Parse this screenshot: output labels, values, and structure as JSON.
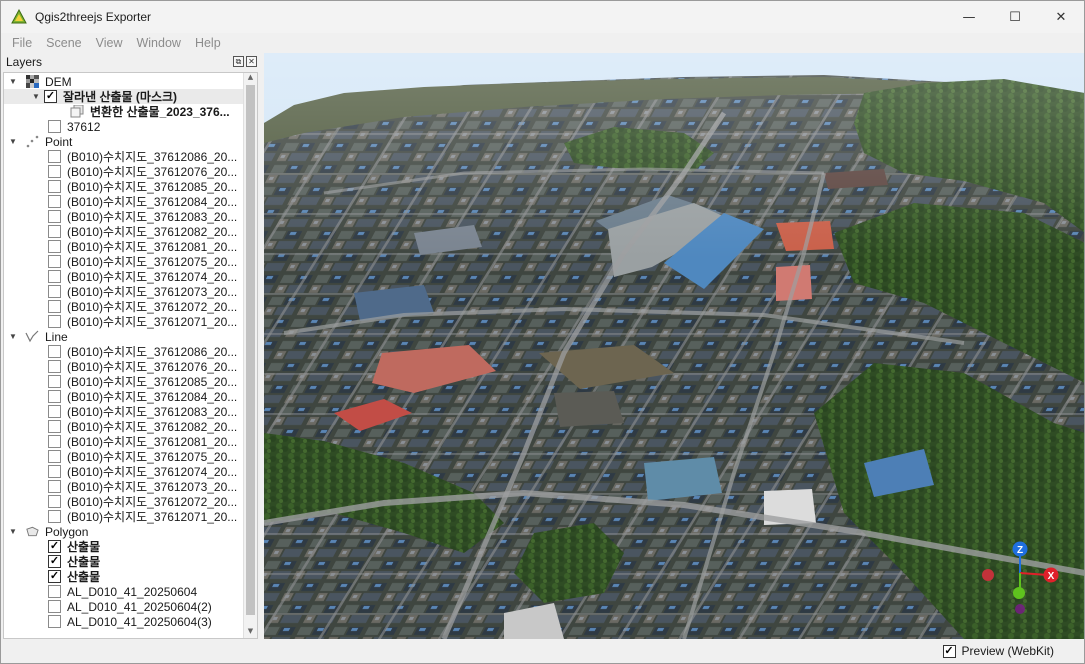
{
  "window": {
    "title": "Qgis2threejs Exporter",
    "minimize_glyph": "—",
    "maximize_glyph": "☐",
    "close_glyph": "✕"
  },
  "menu": [
    "File",
    "Scene",
    "View",
    "Window",
    "Help"
  ],
  "layers_panel": {
    "title": "Layers",
    "float_glyph": "⧉",
    "close_glyph": "✕",
    "groups": {
      "dem": {
        "label": "DEM",
        "icon": "dem-raster-icon",
        "children": [
          {
            "label": "잘라낸 산출물 (마스크)",
            "checked": true,
            "bold": true,
            "expanded": true
          },
          {
            "label": "변환한 산출물_2023_376...",
            "bold": true,
            "icon": "texture-layer-icon"
          },
          {
            "label": "37612",
            "checked": false
          }
        ]
      },
      "point": {
        "label": "Point",
        "icon": "point-layer-icon",
        "items": [
          "(B010)수치지도_37612086_20...",
          "(B010)수치지도_37612076_20...",
          "(B010)수치지도_37612085_20...",
          "(B010)수치지도_37612084_20...",
          "(B010)수치지도_37612083_20...",
          "(B010)수치지도_37612082_20...",
          "(B010)수치지도_37612081_20...",
          "(B010)수치지도_37612075_20...",
          "(B010)수치지도_37612074_20...",
          "(B010)수치지도_37612073_20...",
          "(B010)수치지도_37612072_20...",
          "(B010)수치지도_37612071_20..."
        ]
      },
      "line": {
        "label": "Line",
        "icon": "line-layer-icon",
        "items": [
          "(B010)수치지도_37612086_20...",
          "(B010)수치지도_37612076_20...",
          "(B010)수치지도_37612085_20...",
          "(B010)수치지도_37612084_20...",
          "(B010)수치지도_37612083_20...",
          "(B010)수치지도_37612082_20...",
          "(B010)수치지도_37612081_20...",
          "(B010)수치지도_37612075_20...",
          "(B010)수치지도_37612074_20...",
          "(B010)수치지도_37612073_20...",
          "(B010)수치지도_37612072_20...",
          "(B010)수치지도_37612071_20..."
        ]
      },
      "polygon": {
        "label": "Polygon",
        "icon": "polygon-layer-icon",
        "items": [
          {
            "label": "산출물",
            "checked": true,
            "bold": true
          },
          {
            "label": "산출물",
            "checked": true,
            "bold": true
          },
          {
            "label": "산출물",
            "checked": true,
            "bold": true
          },
          {
            "label": "AL_D010_41_20250604",
            "checked": false,
            "bold": false
          },
          {
            "label": "AL_D010_41_20250604(2)",
            "checked": false,
            "bold": false
          },
          {
            "label": "AL_D010_41_20250604(3)",
            "checked": false,
            "bold": false
          }
        ]
      }
    }
  },
  "view": {
    "axis_labels": {
      "z": "Z",
      "x": "X"
    },
    "colors": {
      "x_axis": "#e0202a",
      "z_axis": "#1f6fe0",
      "y_axis": "#5fc21e",
      "origin": "#c2323a"
    }
  },
  "statusbar": {
    "preview_label": "Preview (WebKit)",
    "preview_checked": true
  },
  "colors": {
    "accent_app_icon": "#6aa51e",
    "menu_disabled": "#8c8c8c",
    "check_glyph": "✓"
  }
}
